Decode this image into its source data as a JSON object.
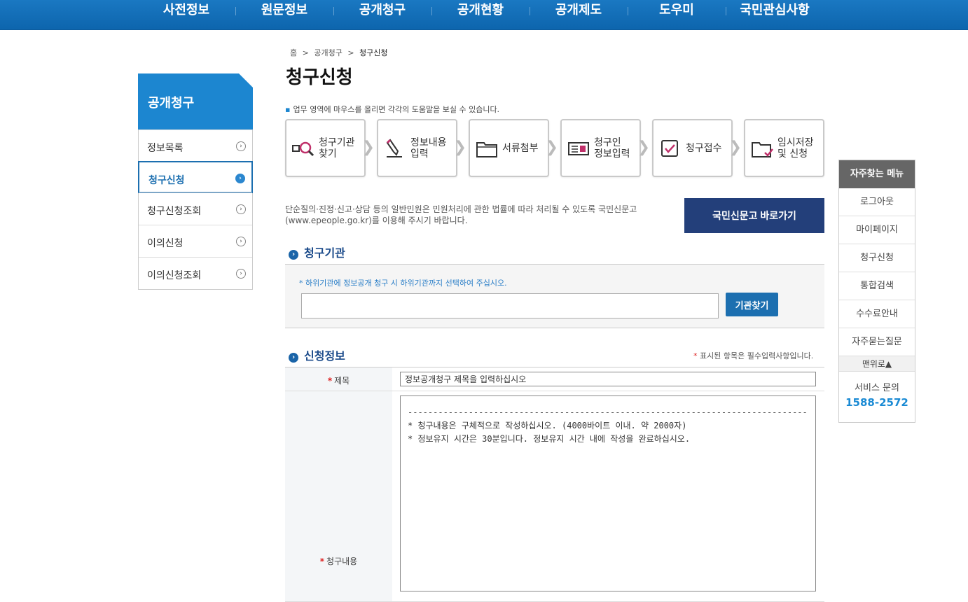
{
  "topnav": {
    "items": [
      "사전정보",
      "원문정보",
      "공개청구",
      "공개현황",
      "공개제도",
      "도우미",
      "국민관심사항"
    ]
  },
  "sidebar": {
    "title": "공개청구",
    "items": [
      {
        "label": "정보목록",
        "active": false
      },
      {
        "label": "청구신청",
        "active": true
      },
      {
        "label": "청구신청조회",
        "active": false
      },
      {
        "label": "이의신청",
        "active": false
      },
      {
        "label": "이의신청조회",
        "active": false
      }
    ]
  },
  "breadcrumb": {
    "home": "홈",
    "parent": "공개청구",
    "current": "청구신청",
    "sep": ">"
  },
  "page_title": "청구신청",
  "guide": "업무 영역에 마우스를 올리면 각각의 도움말을 보실 수 있습니다.",
  "steps": [
    {
      "label1": "청구기관",
      "label2": "찾기",
      "icon": "search-org-icon"
    },
    {
      "label1": "정보내용",
      "label2": "입력",
      "icon": "pencil-icon"
    },
    {
      "label1": "서류첨부",
      "label2": "",
      "icon": "folder-icon"
    },
    {
      "label1": "청구인",
      "label2": "정보입력",
      "icon": "id-card-icon"
    },
    {
      "label1": "청구접수",
      "label2": "",
      "icon": "check-box-icon"
    },
    {
      "label1": "임시저장",
      "label2": "및 신청",
      "icon": "folder-save-icon"
    }
  ],
  "notice": "단순질의·진정·신고·상담 등의 일반민원은 민원처리에 관한 법률에 따라 처리될 수 있도록 국민신문고 (www.epeople.go.kr)를 이용해 주시기 바랍니다.",
  "epeople_button": "국민신문고 바로가기",
  "org_section": {
    "title": "청구기관",
    "hint": "* 하위기관에 정보공개 청구 시 하위기관까지 선택하여 주십시오.",
    "input_value": "",
    "button": "기관찾기"
  },
  "apply_section": {
    "title": "신청정보",
    "required_note": "표시된 항목은 필수입력사항입니다.",
    "subject_label": "제목",
    "subject_value": "정보공개청구 제목을 입력하십시오",
    "content_label": "청구내용",
    "content_dashes": "----------------------------------------------------------------------------------",
    "content_line1": " * 청구내용은 구체적으로 작성하십시오. (4000바이트 이내. 약 2000자)",
    "content_line2": " * 정보유지 시간은 30분입니다. 정보유지 시간 내에 작성을 완료하십시오."
  },
  "quick_menu": {
    "title": "자주찾는 메뉴",
    "items": [
      "로그아웃",
      "마이페이지",
      "청구신청",
      "통합검색",
      "수수료안내",
      "자주묻는질문"
    ],
    "top": "맨위로▲",
    "service_label": "서비스 문의",
    "service_phone": "1588-2572"
  },
  "colors": {
    "primary": "#1c86d0",
    "nav": "#1572ba",
    "epeople": "#233f7a",
    "required": "#dd2222"
  }
}
